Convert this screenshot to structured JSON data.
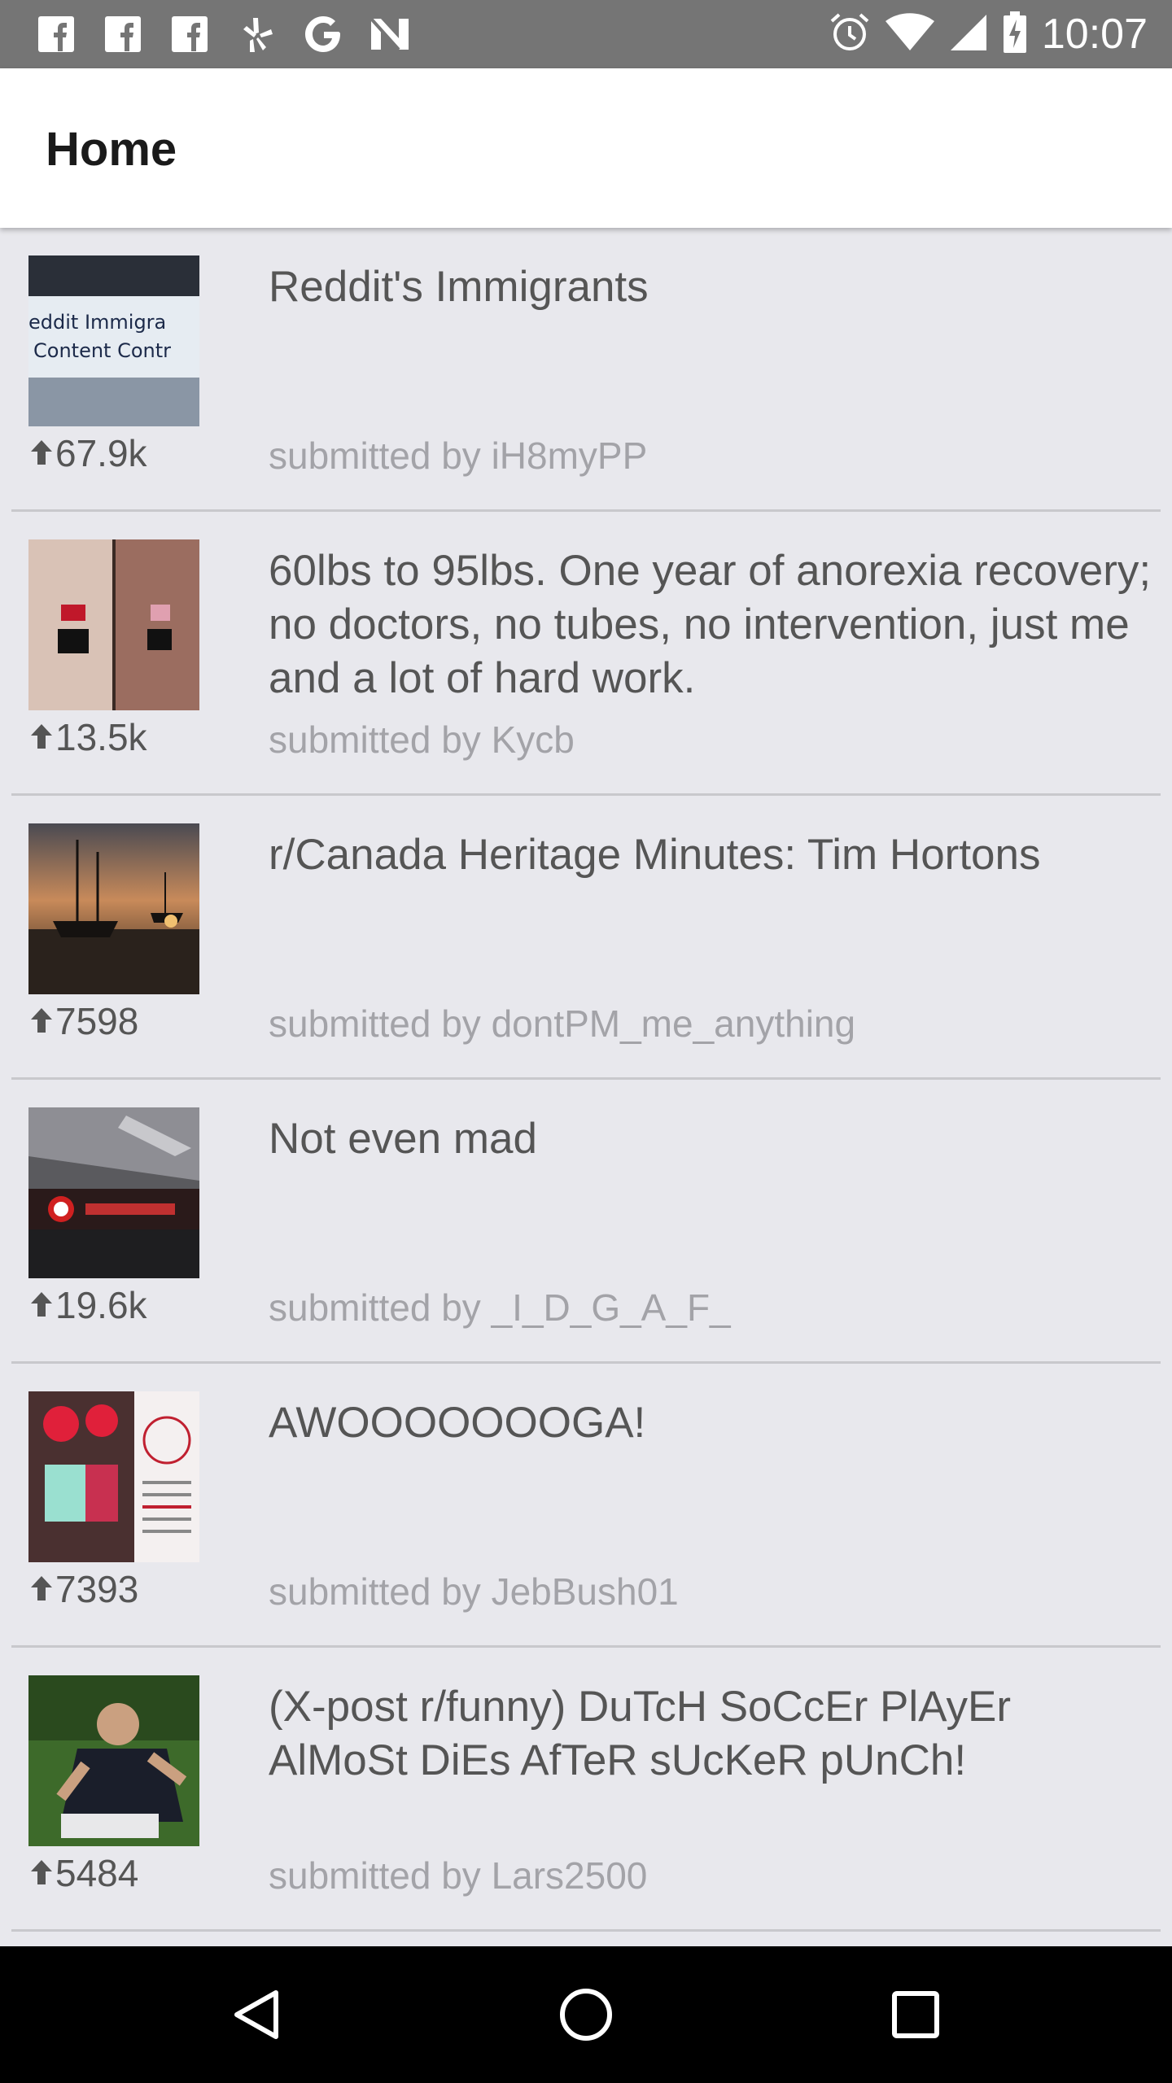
{
  "status_bar": {
    "time": "10:07",
    "left_icons": [
      "facebook-icon",
      "facebook-icon",
      "facebook-icon",
      "yelp-icon",
      "google-icon",
      "n-app-icon"
    ],
    "right_icons": [
      "alarm-icon",
      "wifi-icon",
      "signal-icon",
      "battery-charging-icon"
    ]
  },
  "app_bar": {
    "title": "Home"
  },
  "posts": [
    {
      "title": "Reddit's Immigrants",
      "byline": "submitted by iH8myPP",
      "score": "67.9k",
      "thumb_text_1": "eddit Immigra",
      "thumb_text_2": "Content Contr"
    },
    {
      "title": "60lbs to 95lbs. One year of anorexia recovery; no doctors, no tubes, no intervention, just me and a lot of hard work.",
      "byline": "submitted by Kycb",
      "score": "13.5k"
    },
    {
      "title": "r/Canada Heritage Minutes: Tim Hortons",
      "byline": "submitted by dontPM_me_anything",
      "score": "7598"
    },
    {
      "title": "Not even mad",
      "byline": "submitted by _I_D_G_A_F_",
      "score": "19.6k"
    },
    {
      "title": "AWOOOOOOOGA!",
      "byline": "submitted by JebBush01",
      "score": "7393"
    },
    {
      "title": "(X-post r/funny) DuTcH SoCcEr PlAyEr AlMoSt DiEs AfTeR sUcKeR pUnCh!",
      "byline": "submitted by Lars2500",
      "score": "5484"
    }
  ],
  "nav_bar": {
    "buttons": [
      "back-icon",
      "home-icon",
      "recents-icon"
    ]
  },
  "colors": {
    "status_bar": "#757575",
    "app_bar": "#ffffff",
    "feed_bg": "#e8e8ed",
    "title_text": "#555555",
    "byline_text": "#a3a3a8",
    "nav_bar": "#000000"
  }
}
